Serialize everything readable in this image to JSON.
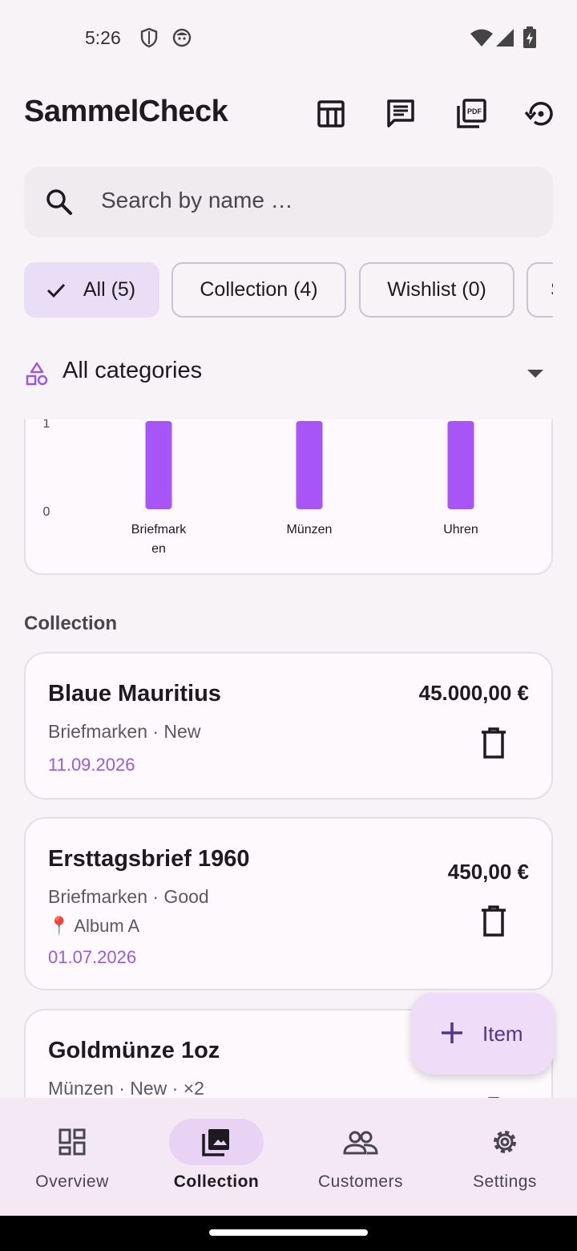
{
  "status_bar": {
    "time": "5:26",
    "icons": [
      "shield-icon",
      "face-icon",
      "wifi-icon",
      "signal-icon",
      "battery-charging-icon"
    ]
  },
  "app_bar": {
    "title": "SammelCheck",
    "actions": [
      "table-icon",
      "chat-icon",
      "pdf-icon",
      "restore-icon"
    ]
  },
  "search": {
    "placeholder": "Search by name …"
  },
  "filter_chips": [
    {
      "label": "All (5)",
      "selected": true
    },
    {
      "label": "Collection (4)",
      "selected": false
    },
    {
      "label": "Wishlist (0)",
      "selected": false
    },
    {
      "label": "S",
      "selected": false
    }
  ],
  "category_filter": {
    "label": "All categories"
  },
  "chart_data": {
    "type": "bar",
    "categories": [
      "Briefmarken",
      "Münzen",
      "Uhren"
    ],
    "category_lines": [
      [
        "Briefmark",
        "en"
      ],
      [
        "Münzen"
      ],
      [
        "Uhren"
      ]
    ],
    "values": [
      1,
      1,
      1
    ],
    "ytick_labels": [
      "0",
      "1"
    ],
    "ylim": [
      0,
      1
    ],
    "color": "#a855f7",
    "grid": false
  },
  "section_title": "Collection",
  "items": [
    {
      "name": "Blaue Mauritius",
      "meta": "Briefmarken · New",
      "location": "",
      "date": "11.09.2026",
      "price": "45.000,00 €"
    },
    {
      "name": "Ersttagsbrief 1960",
      "meta": "Briefmarken · Good",
      "location": "📍 Album A",
      "date": "01.07.2026",
      "price": "450,00 €"
    },
    {
      "name": "Goldmünze 1oz",
      "meta": "Münzen · New · ×2",
      "location": "",
      "date": "",
      "price": ""
    }
  ],
  "fab": {
    "label": "Item"
  },
  "bottom_nav": [
    {
      "label": "Overview",
      "icon": "dashboard-icon",
      "active": false
    },
    {
      "label": "Collection",
      "icon": "collections-icon",
      "active": true
    },
    {
      "label": "Customers",
      "icon": "people-icon",
      "active": false
    },
    {
      "label": "Settings",
      "icon": "settings-icon",
      "active": false
    }
  ],
  "colors": {
    "accent": "#a855f7",
    "date_text": "#9b5bd9",
    "chip_selected": "#eaddf6",
    "fab_bg": "#eedcf8",
    "nav_bg": "#f3e8f3"
  }
}
